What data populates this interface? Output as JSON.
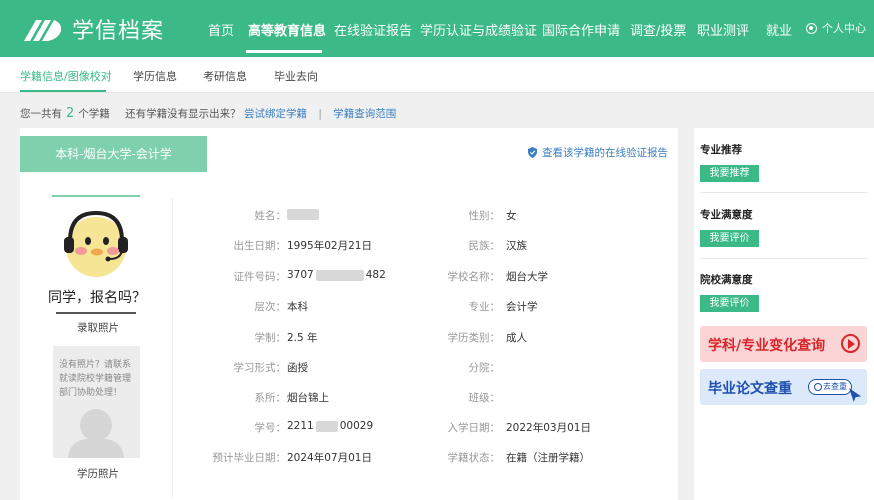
{
  "header": {
    "logo_text": "学信档案",
    "nav": [
      "首页",
      "高等教育信息",
      "在线验证报告",
      "学历认证与成绩验证",
      "国际合作申请",
      "调查/投票",
      "职业测评",
      "就业"
    ],
    "active_nav": "高等教育信息",
    "user": "个人中心"
  },
  "subnav": {
    "tabs": [
      "学籍信息/图像校对",
      "学历信息",
      "考研信息",
      "毕业去向"
    ],
    "active": "学籍信息/图像校对"
  },
  "info": {
    "prefix": "您一共有",
    "count": "2",
    "suffix": "个学籍",
    "question": "还有学籍没有显示出来？",
    "link1": "尝试绑定学籍",
    "sep": "|",
    "link2": "学籍查询范围"
  },
  "record": {
    "degree_tab": "本科-烟台大学-会计学",
    "verify_link": "查看该学籍的在线验证报告",
    "photo1_text": "同学，报名吗？",
    "photo1_caption": "录取照片",
    "photo2_text": "没有照片？请联系就读院校学籍管理部门协助处理！",
    "photo2_caption": "学历照片",
    "fields_left": [
      {
        "label": "姓名：",
        "value": ""
      },
      {
        "label": "出生日期：",
        "value": "1995年02月21日"
      },
      {
        "label": "证件号码：",
        "value_a": "3707",
        "value_b": "482"
      },
      {
        "label": "层次：",
        "value": "本科"
      },
      {
        "label": "学制：",
        "value": "2.5 年"
      },
      {
        "label": "学习形式：",
        "value": "函授"
      },
      {
        "label": "系所：",
        "value": "烟台锦上"
      },
      {
        "label": "学号：",
        "value_a": "2211",
        "value_b": "00029"
      },
      {
        "label": "预计毕业日期：",
        "value": "2024年07月01日"
      }
    ],
    "fields_right": [
      {
        "label": "性别：",
        "value": "女"
      },
      {
        "label": "民族：",
        "value": "汉族"
      },
      {
        "label": "学校名称：",
        "value": "烟台大学"
      },
      {
        "label": "专业：",
        "value": "会计学"
      },
      {
        "label": "学历类别：",
        "value": "成人"
      },
      {
        "label": "分院：",
        "value": ""
      },
      {
        "label": "班级：",
        "value": ""
      },
      {
        "label": "入学日期：",
        "value": "2022年03月01日"
      },
      {
        "label": "学籍状态：",
        "value": "在籍（注册学籍）"
      }
    ]
  },
  "sidebar": {
    "sections": [
      {
        "title": "专业推荐",
        "button": "我要推荐"
      },
      {
        "title": "专业满意度",
        "button": "我要评价"
      },
      {
        "title": "院校满意度",
        "button": "我要评价"
      }
    ],
    "banner1": "学科/专业变化查询",
    "banner2": "毕业论文查重",
    "banner2_pill": "去查重"
  },
  "colors": {
    "brand": "#3bb986",
    "tab": "#7fd1ae",
    "link": "#3a7fc1"
  }
}
